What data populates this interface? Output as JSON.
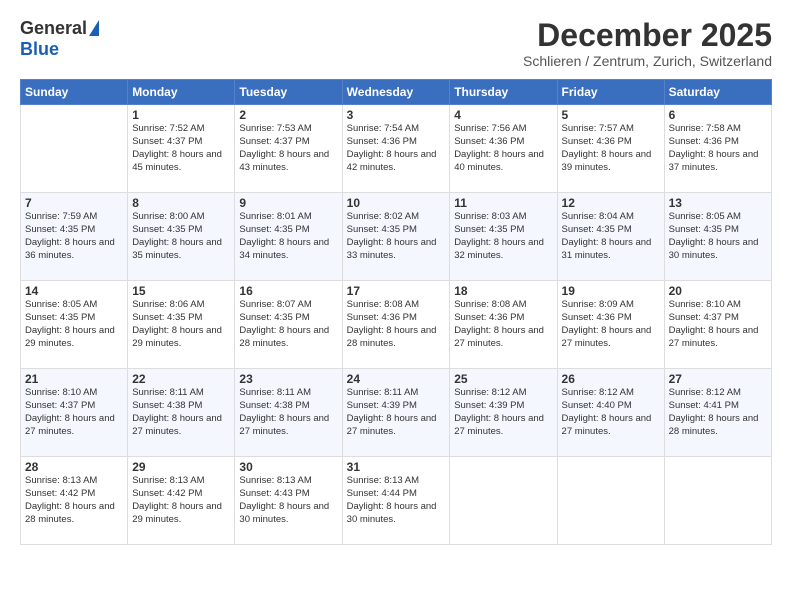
{
  "header": {
    "logo_general": "General",
    "logo_blue": "Blue",
    "month_title": "December 2025",
    "subtitle": "Schlieren / Zentrum, Zurich, Switzerland"
  },
  "weekdays": [
    "Sunday",
    "Monday",
    "Tuesday",
    "Wednesday",
    "Thursday",
    "Friday",
    "Saturday"
  ],
  "weeks": [
    [
      {
        "day": "",
        "info": ""
      },
      {
        "day": "1",
        "info": "Sunrise: 7:52 AM\nSunset: 4:37 PM\nDaylight: 8 hours\nand 45 minutes."
      },
      {
        "day": "2",
        "info": "Sunrise: 7:53 AM\nSunset: 4:37 PM\nDaylight: 8 hours\nand 43 minutes."
      },
      {
        "day": "3",
        "info": "Sunrise: 7:54 AM\nSunset: 4:36 PM\nDaylight: 8 hours\nand 42 minutes."
      },
      {
        "day": "4",
        "info": "Sunrise: 7:56 AM\nSunset: 4:36 PM\nDaylight: 8 hours\nand 40 minutes."
      },
      {
        "day": "5",
        "info": "Sunrise: 7:57 AM\nSunset: 4:36 PM\nDaylight: 8 hours\nand 39 minutes."
      },
      {
        "day": "6",
        "info": "Sunrise: 7:58 AM\nSunset: 4:36 PM\nDaylight: 8 hours\nand 37 minutes."
      }
    ],
    [
      {
        "day": "7",
        "info": "Sunrise: 7:59 AM\nSunset: 4:35 PM\nDaylight: 8 hours\nand 36 minutes."
      },
      {
        "day": "8",
        "info": "Sunrise: 8:00 AM\nSunset: 4:35 PM\nDaylight: 8 hours\nand 35 minutes."
      },
      {
        "day": "9",
        "info": "Sunrise: 8:01 AM\nSunset: 4:35 PM\nDaylight: 8 hours\nand 34 minutes."
      },
      {
        "day": "10",
        "info": "Sunrise: 8:02 AM\nSunset: 4:35 PM\nDaylight: 8 hours\nand 33 minutes."
      },
      {
        "day": "11",
        "info": "Sunrise: 8:03 AM\nSunset: 4:35 PM\nDaylight: 8 hours\nand 32 minutes."
      },
      {
        "day": "12",
        "info": "Sunrise: 8:04 AM\nSunset: 4:35 PM\nDaylight: 8 hours\nand 31 minutes."
      },
      {
        "day": "13",
        "info": "Sunrise: 8:05 AM\nSunset: 4:35 PM\nDaylight: 8 hours\nand 30 minutes."
      }
    ],
    [
      {
        "day": "14",
        "info": "Sunrise: 8:05 AM\nSunset: 4:35 PM\nDaylight: 8 hours\nand 29 minutes."
      },
      {
        "day": "15",
        "info": "Sunrise: 8:06 AM\nSunset: 4:35 PM\nDaylight: 8 hours\nand 29 minutes."
      },
      {
        "day": "16",
        "info": "Sunrise: 8:07 AM\nSunset: 4:35 PM\nDaylight: 8 hours\nand 28 minutes."
      },
      {
        "day": "17",
        "info": "Sunrise: 8:08 AM\nSunset: 4:36 PM\nDaylight: 8 hours\nand 28 minutes."
      },
      {
        "day": "18",
        "info": "Sunrise: 8:08 AM\nSunset: 4:36 PM\nDaylight: 8 hours\nand 27 minutes."
      },
      {
        "day": "19",
        "info": "Sunrise: 8:09 AM\nSunset: 4:36 PM\nDaylight: 8 hours\nand 27 minutes."
      },
      {
        "day": "20",
        "info": "Sunrise: 8:10 AM\nSunset: 4:37 PM\nDaylight: 8 hours\nand 27 minutes."
      }
    ],
    [
      {
        "day": "21",
        "info": "Sunrise: 8:10 AM\nSunset: 4:37 PM\nDaylight: 8 hours\nand 27 minutes."
      },
      {
        "day": "22",
        "info": "Sunrise: 8:11 AM\nSunset: 4:38 PM\nDaylight: 8 hours\nand 27 minutes."
      },
      {
        "day": "23",
        "info": "Sunrise: 8:11 AM\nSunset: 4:38 PM\nDaylight: 8 hours\nand 27 minutes."
      },
      {
        "day": "24",
        "info": "Sunrise: 8:11 AM\nSunset: 4:39 PM\nDaylight: 8 hours\nand 27 minutes."
      },
      {
        "day": "25",
        "info": "Sunrise: 8:12 AM\nSunset: 4:39 PM\nDaylight: 8 hours\nand 27 minutes."
      },
      {
        "day": "26",
        "info": "Sunrise: 8:12 AM\nSunset: 4:40 PM\nDaylight: 8 hours\nand 27 minutes."
      },
      {
        "day": "27",
        "info": "Sunrise: 8:12 AM\nSunset: 4:41 PM\nDaylight: 8 hours\nand 28 minutes."
      }
    ],
    [
      {
        "day": "28",
        "info": "Sunrise: 8:13 AM\nSunset: 4:42 PM\nDaylight: 8 hours\nand 28 minutes."
      },
      {
        "day": "29",
        "info": "Sunrise: 8:13 AM\nSunset: 4:42 PM\nDaylight: 8 hours\nand 29 minutes."
      },
      {
        "day": "30",
        "info": "Sunrise: 8:13 AM\nSunset: 4:43 PM\nDaylight: 8 hours\nand 30 minutes."
      },
      {
        "day": "31",
        "info": "Sunrise: 8:13 AM\nSunset: 4:44 PM\nDaylight: 8 hours\nand 30 minutes."
      },
      {
        "day": "",
        "info": ""
      },
      {
        "day": "",
        "info": ""
      },
      {
        "day": "",
        "info": ""
      }
    ]
  ]
}
